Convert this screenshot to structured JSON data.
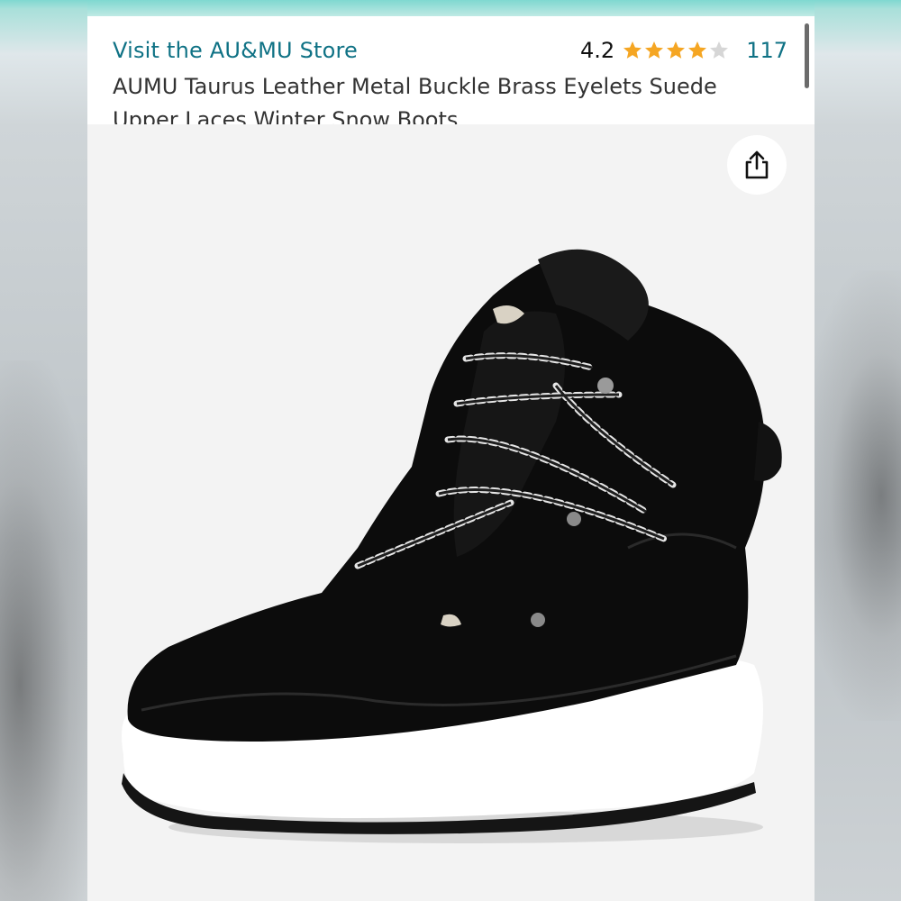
{
  "header": {
    "store_link": "Visit the AU&MU Store",
    "rating_value": "4.2",
    "rating": 4.2,
    "rating_max": 5,
    "review_count": "117",
    "product_title": "AUMU Taurus Leather Metal Buckle Brass Eyelets Suede Upper Laces Winter Snow Boots…"
  },
  "icons": {
    "share": "share-icon",
    "star_filled": "star-filled-icon",
    "star_empty": "star-empty-icon"
  },
  "colors": {
    "link": "#0f7285",
    "star": "#f5a623",
    "star_empty": "#d6d6d6",
    "accent_bar": "#7fd8d0"
  }
}
